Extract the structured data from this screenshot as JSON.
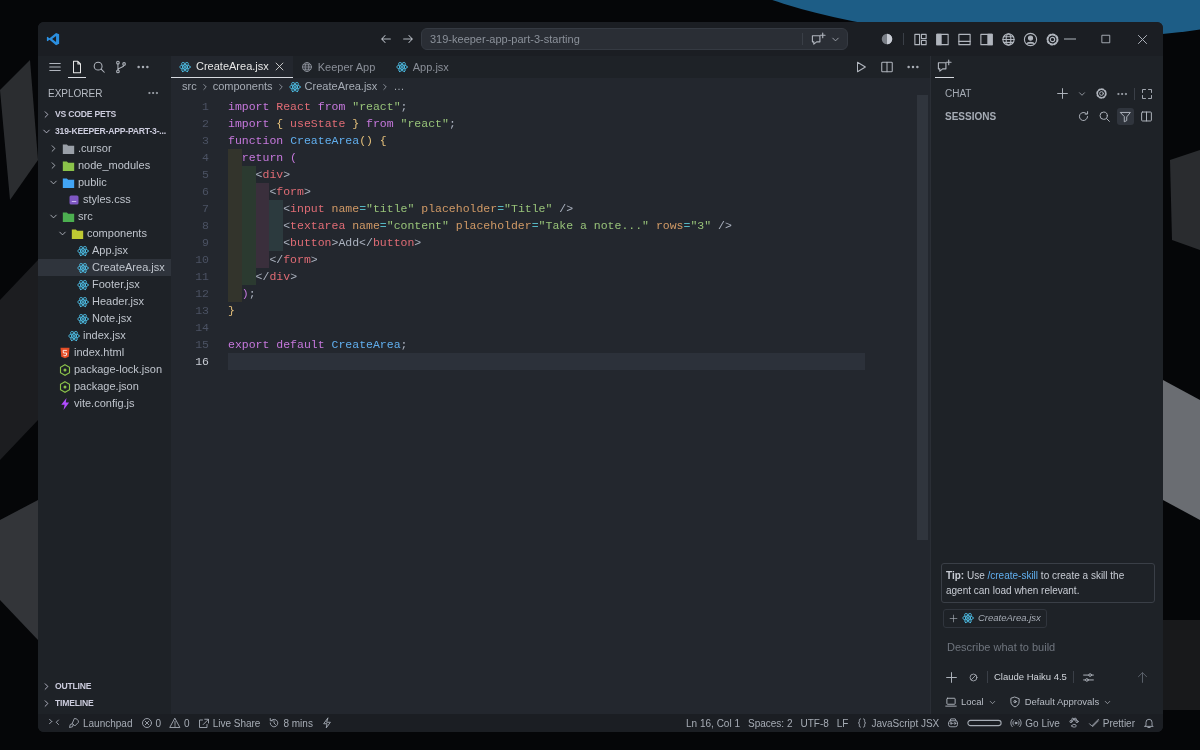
{
  "window": {
    "command_center": "319-keeper-app-part-3-starting"
  },
  "activity": [
    {
      "kind": "menu",
      "selected": false
    },
    {
      "kind": "files",
      "selected": true
    },
    {
      "kind": "search",
      "selected": false
    },
    {
      "kind": "branch",
      "selected": false
    },
    {
      "kind": "more",
      "selected": false
    }
  ],
  "sidebar": {
    "title": "EXPLORER",
    "sections": [
      {
        "label": "VS CODE PETS",
        "expanded": false
      },
      {
        "label": "319-KEEPER-APP-PART-3-...",
        "expanded": true,
        "children": [
          {
            "label": ".cursor",
            "kind": "folder-cursor",
            "expanded": false,
            "selected": false
          },
          {
            "label": "node_modules",
            "kind": "folder-node",
            "expanded": false,
            "selected": false
          },
          {
            "label": "public",
            "kind": "folder-public",
            "expanded": true,
            "selected": false,
            "children": [
              {
                "label": "styles.css",
                "kind": "css",
                "selected": false
              }
            ]
          },
          {
            "label": "src",
            "kind": "folder-src",
            "expanded": true,
            "selected": false,
            "children": [
              {
                "label": "components",
                "kind": "folder-components",
                "expanded": true,
                "selected": false,
                "children": [
                  {
                    "label": "App.jsx",
                    "kind": "react",
                    "selected": false
                  },
                  {
                    "label": "CreateArea.jsx",
                    "kind": "react",
                    "selected": true
                  },
                  {
                    "label": "Footer.jsx",
                    "kind": "react",
                    "selected": false
                  },
                  {
                    "label": "Header.jsx",
                    "kind": "react",
                    "selected": false
                  },
                  {
                    "label": "Note.jsx",
                    "kind": "react",
                    "selected": false
                  }
                ]
              },
              {
                "label": "index.jsx",
                "kind": "react",
                "selected": false
              }
            ]
          },
          {
            "label": "index.html",
            "kind": "html",
            "selected": false
          },
          {
            "label": "package-lock.json",
            "kind": "json",
            "selected": false
          },
          {
            "label": "package.json",
            "kind": "json",
            "selected": false
          },
          {
            "label": "vite.config.js",
            "kind": "vite",
            "selected": false
          }
        ]
      }
    ],
    "bottom_sections": [
      {
        "label": "OUTLINE",
        "expanded": false
      },
      {
        "label": "TIMELINE",
        "expanded": false
      }
    ]
  },
  "tabs": [
    {
      "label": "CreateArea.jsx",
      "kind": "react",
      "selected": true
    },
    {
      "label": "Keeper App",
      "kind": "globe",
      "selected": false
    },
    {
      "label": "App.jsx",
      "kind": "react",
      "selected": false
    }
  ],
  "breadcrumb": [
    {
      "label": "src"
    },
    {
      "label": "components"
    },
    {
      "label": "CreateArea.jsx",
      "kind": "react"
    },
    {
      "label": "…"
    }
  ],
  "code": [
    {
      "number": "1",
      "current": false,
      "tokens": [
        {
          "t": "import ",
          "kind": "keyword"
        },
        {
          "t": "React ",
          "kind": "variable"
        },
        {
          "t": "from ",
          "kind": "keyword"
        },
        {
          "t": "\"react\"",
          "kind": "string"
        },
        {
          "t": ";",
          "kind": "plain"
        }
      ]
    },
    {
      "number": "2",
      "current": false,
      "tokens": [
        {
          "t": "import ",
          "kind": "keyword"
        },
        {
          "t": "{",
          "kind": "bracket"
        },
        {
          "t": " useState ",
          "kind": "variable"
        },
        {
          "t": "}",
          "kind": "bracket"
        },
        {
          "t": " from ",
          "kind": "keyword"
        },
        {
          "t": "\"react\"",
          "kind": "string"
        },
        {
          "t": ";",
          "kind": "plain"
        }
      ]
    },
    {
      "number": "3",
      "current": false,
      "tokens": [
        {
          "t": "function ",
          "kind": "keyword"
        },
        {
          "t": "CreateArea",
          "kind": "function"
        },
        {
          "t": "() {",
          "kind": "bracket"
        }
      ]
    },
    {
      "number": "4",
      "current": false,
      "tokens": [
        {
          "t": "  return ",
          "kind": "keyword"
        },
        {
          "t": "(",
          "kind": "paren"
        }
      ]
    },
    {
      "number": "5",
      "current": false,
      "tokens": [
        {
          "t": "    <",
          "kind": "plain"
        },
        {
          "t": "div",
          "kind": "tag"
        },
        {
          "t": ">",
          "kind": "plain"
        }
      ]
    },
    {
      "number": "6",
      "current": false,
      "tokens": [
        {
          "t": "      <",
          "kind": "plain"
        },
        {
          "t": "form",
          "kind": "tag"
        },
        {
          "t": ">",
          "kind": "plain"
        }
      ]
    },
    {
      "number": "7",
      "current": false,
      "tokens": [
        {
          "t": "        <",
          "kind": "plain"
        },
        {
          "t": "input",
          "kind": "tag"
        },
        {
          "t": " name",
          "kind": "attribute"
        },
        {
          "t": "=",
          "kind": "operator"
        },
        {
          "t": "\"title\"",
          "kind": "string"
        },
        {
          "t": " placeholder",
          "kind": "attribute"
        },
        {
          "t": "=",
          "kind": "operator"
        },
        {
          "t": "\"Title\"",
          "kind": "string"
        },
        {
          "t": " />",
          "kind": "plain"
        }
      ]
    },
    {
      "number": "8",
      "current": false,
      "tokens": [
        {
          "t": "        <",
          "kind": "plain"
        },
        {
          "t": "textarea",
          "kind": "tag"
        },
        {
          "t": " name",
          "kind": "attribute"
        },
        {
          "t": "=",
          "kind": "operator"
        },
        {
          "t": "\"content\"",
          "kind": "string"
        },
        {
          "t": " placeholder",
          "kind": "attribute"
        },
        {
          "t": "=",
          "kind": "operator"
        },
        {
          "t": "\"Take a note...\"",
          "kind": "string"
        },
        {
          "t": " rows",
          "kind": "attribute"
        },
        {
          "t": "=",
          "kind": "operator"
        },
        {
          "t": "\"3\"",
          "kind": "string"
        },
        {
          "t": " />",
          "kind": "plain"
        }
      ]
    },
    {
      "number": "9",
      "current": false,
      "tokens": [
        {
          "t": "        <",
          "kind": "plain"
        },
        {
          "t": "button",
          "kind": "tag"
        },
        {
          "t": ">Add</",
          "kind": "plain"
        },
        {
          "t": "button",
          "kind": "tag"
        },
        {
          "t": ">",
          "kind": "plain"
        }
      ]
    },
    {
      "number": "10",
      "current": false,
      "tokens": [
        {
          "t": "      </",
          "kind": "plain"
        },
        {
          "t": "form",
          "kind": "tag"
        },
        {
          "t": ">",
          "kind": "plain"
        }
      ]
    },
    {
      "number": "11",
      "current": false,
      "tokens": [
        {
          "t": "    </",
          "kind": "plain"
        },
        {
          "t": "div",
          "kind": "tag"
        },
        {
          "t": ">",
          "kind": "plain"
        }
      ]
    },
    {
      "number": "12",
      "current": false,
      "tokens": [
        {
          "t": "  )",
          "kind": "paren"
        },
        {
          "t": ";",
          "kind": "plain"
        }
      ]
    },
    {
      "number": "13",
      "current": false,
      "tokens": [
        {
          "t": "}",
          "kind": "bracket"
        }
      ]
    },
    {
      "number": "14",
      "current": false
    },
    {
      "number": "15",
      "current": false,
      "tokens": [
        {
          "t": "export ",
          "kind": "keyword"
        },
        {
          "t": "default ",
          "kind": "keyword"
        },
        {
          "t": "CreateArea",
          "kind": "function"
        },
        {
          "t": ";",
          "kind": "plain"
        }
      ]
    },
    {
      "number": "16",
      "current": true
    }
  ],
  "chat": {
    "title": "CHAT",
    "sessions": "SESSIONS",
    "tip": {
      "label": "Tip:",
      "before": "Use",
      "link": "/create-skill",
      "after": "to create a skill the agent can load when relevant."
    },
    "attachment": "CreateArea.jsx",
    "placeholder": "Describe what to build",
    "model": "Claude Haiku 4.5",
    "location": "Local",
    "approvals": "Default Approvals"
  },
  "status_bar": {
    "left": [
      {
        "kind": "remote"
      },
      {
        "kind": "rocket",
        "text": "Launchpad"
      },
      {
        "kind": "error",
        "text": "0"
      },
      {
        "kind": "warning",
        "text": "0"
      },
      {
        "kind": "share",
        "text": "Live Share"
      },
      {
        "kind": "history",
        "text": "8 mins"
      },
      {
        "kind": "bolt"
      }
    ],
    "right": [
      {
        "text": "Ln 16, Col 1"
      },
      {
        "text": "Spaces: 2"
      },
      {
        "text": "UTF-8"
      },
      {
        "text": "LF"
      },
      {
        "kind": "braces",
        "text": "JavaScript JSX"
      },
      {
        "kind": "robot"
      },
      {
        "kind": "pill"
      },
      {
        "kind": "broadcast",
        "text": "Go Live"
      },
      {
        "kind": "paw"
      },
      {
        "kind": "check",
        "text": "Prettier"
      },
      {
        "kind": "bell"
      }
    ]
  }
}
